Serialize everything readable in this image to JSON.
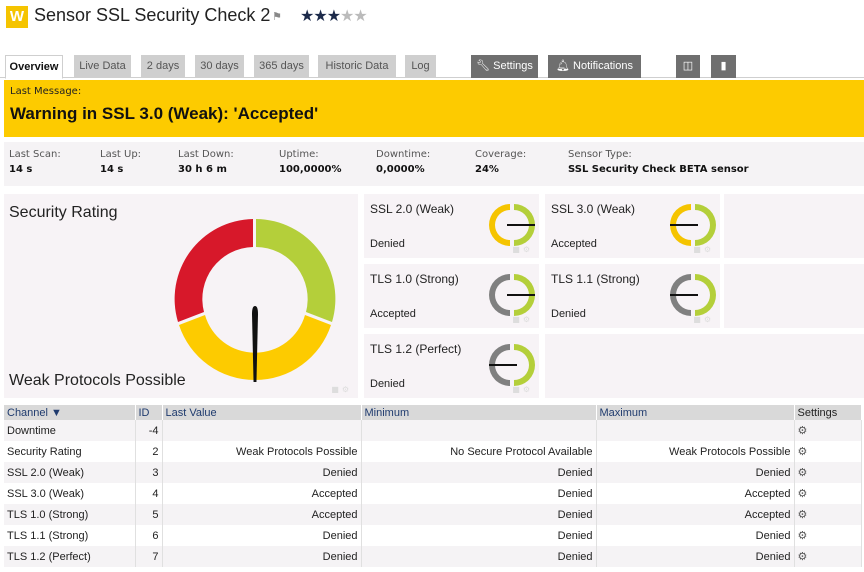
{
  "header": {
    "logo_letter": "W",
    "title": "Sensor SSL Security Check 2",
    "flag_icon": "flag-icon",
    "priority_stars": 3,
    "priority_max": 5,
    "brand_color": "#f5c400"
  },
  "tabs": [
    {
      "label": "Overview",
      "active": true
    },
    {
      "label": "Live Data"
    },
    {
      "label": "2 days"
    },
    {
      "label": "30 days"
    },
    {
      "label": "365 days"
    },
    {
      "label": "Historic Data"
    },
    {
      "label": "Log"
    }
  ],
  "actions": {
    "settings_label": "Settings",
    "notifications_label": "Notifications",
    "comments_icon": "comment-icon",
    "history_icon": "notebook-icon"
  },
  "last_message": {
    "label": "Last Message:",
    "text": "Warning in SSL 3.0 (Weak): 'Accepted'",
    "color": "#fdcb00"
  },
  "stats": [
    {
      "label": "Last Scan:",
      "value": "14 s"
    },
    {
      "label": "Last Up:",
      "value": "14 s"
    },
    {
      "label": "Last Down:",
      "value": "30 h 6 m"
    },
    {
      "label": "Uptime:",
      "value": "100,0000%"
    },
    {
      "label": "Downtime:",
      "value": "0,0000%"
    },
    {
      "label": "Coverage:",
      "value": "24%"
    },
    {
      "label": "Sensor Type:",
      "value": "SSL Security Check BETA sensor"
    }
  ],
  "security_gauge": {
    "title": "Security Rating",
    "value_text": "Weak Protocols Possible",
    "zones": [
      {
        "name": "red",
        "color": "#d7182a"
      },
      {
        "name": "yellow",
        "color": "#fdcb00"
      },
      {
        "name": "green",
        "color": "#b4cf3a"
      }
    ]
  },
  "protocol_gauges": [
    {
      "title": "SSL 2.0 (Weak)",
      "value": "Denied",
      "left_color": "#f5c400",
      "needle": "right"
    },
    {
      "title": "SSL 3.0 (Weak)",
      "value": "Accepted",
      "left_color": "#f5c400",
      "needle": "left"
    },
    {
      "title": "TLS 1.0 (Strong)",
      "value": "Accepted",
      "left_color": "#808080",
      "needle": "right"
    },
    {
      "title": "TLS 1.1 (Strong)",
      "value": "Denied",
      "left_color": "#808080",
      "needle": "left"
    },
    {
      "title": "TLS 1.2 (Perfect)",
      "value": "Denied",
      "left_color": "#808080",
      "needle": "left"
    }
  ],
  "table": {
    "columns": [
      "Channel",
      "ID",
      "Last Value",
      "Minimum",
      "Maximum",
      "Settings"
    ],
    "rows": [
      {
        "channel": "Downtime",
        "id": "-4",
        "last": "",
        "min": "",
        "max": ""
      },
      {
        "channel": "Security Rating",
        "id": "2",
        "last": "Weak Protocols Possible",
        "min": "No Secure Protocol Available",
        "max": "Weak Protocols Possible"
      },
      {
        "channel": "SSL 2.0 (Weak)",
        "id": "3",
        "last": "Denied",
        "min": "Denied",
        "max": "Denied"
      },
      {
        "channel": "SSL 3.0 (Weak)",
        "id": "4",
        "last": "Accepted",
        "min": "Denied",
        "max": "Accepted"
      },
      {
        "channel": "TLS 1.0 (Strong)",
        "id": "5",
        "last": "Accepted",
        "min": "Denied",
        "max": "Accepted"
      },
      {
        "channel": "TLS 1.1 (Strong)",
        "id": "6",
        "last": "Denied",
        "min": "Denied",
        "max": "Denied"
      },
      {
        "channel": "TLS 1.2 (Perfect)",
        "id": "7",
        "last": "Denied",
        "min": "Denied",
        "max": "Denied"
      }
    ]
  }
}
